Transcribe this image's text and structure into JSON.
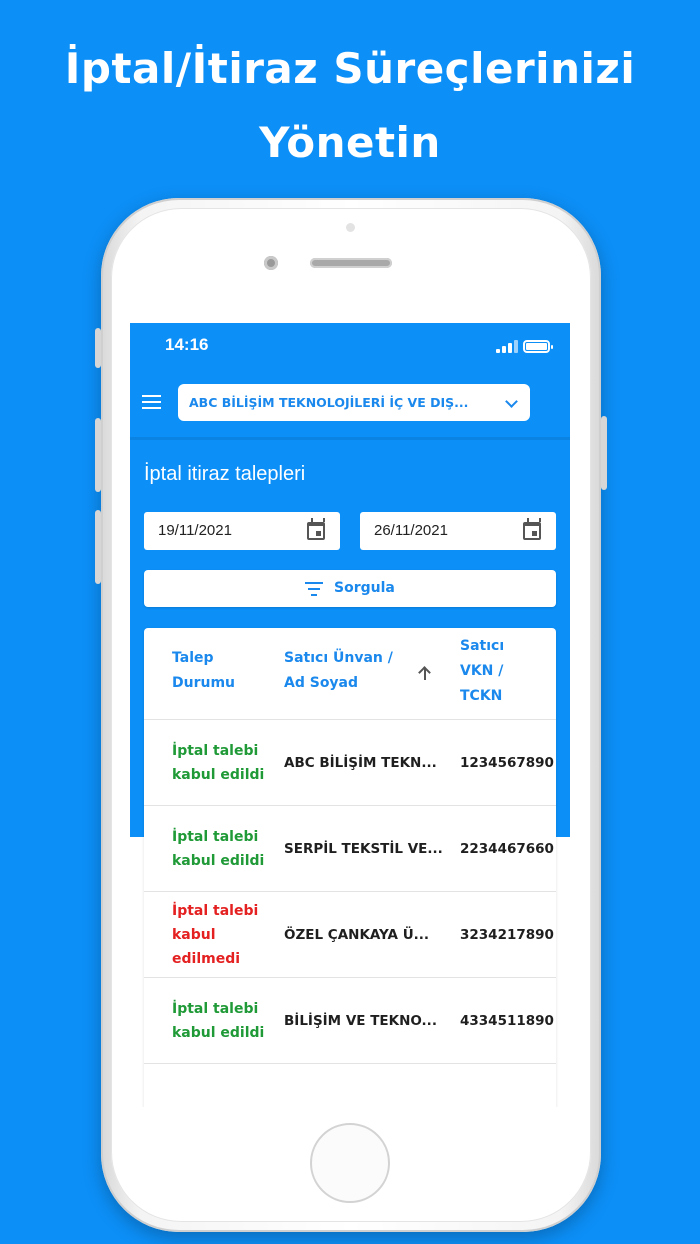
{
  "headline": {
    "line1": "İptal/İtiraz Süreçlerinizi",
    "line2": "Yönetin"
  },
  "status_bar": {
    "time": "14:16"
  },
  "app_bar": {
    "company": "ABC BİLİŞİM TEKNOLOJİLERİ İÇ VE DIŞ..."
  },
  "page": {
    "title": "İptal itiraz talepleri",
    "start_date": "19/11/2021",
    "end_date": "26/11/2021",
    "query_label": "Sorgula"
  },
  "table": {
    "headers": {
      "status": [
        "Talep",
        "Durumu"
      ],
      "seller": [
        "Satıcı Ünvan /",
        "Ad Soyad"
      ],
      "vkn": [
        "Satıcı",
        "VKN /",
        "TCKN"
      ]
    },
    "rows": [
      {
        "status": [
          "İptal talebi",
          "kabul edildi"
        ],
        "name": "ABC BİLİŞİM TEKN...",
        "vkn": "1234567890"
      },
      {
        "status": [
          "İptal talebi",
          "kabul edildi"
        ],
        "name": "SERPİL TEKSTİL VE...",
        "vkn": "2234467660"
      },
      {
        "status": [
          "İptal talebi",
          "kabul",
          "edilmedi"
        ],
        "name": "ÖZEL ÇANKAYA Ü...",
        "vkn": "3234217890"
      },
      {
        "status": [
          "İptal talebi",
          "kabul edildi"
        ],
        "name": "BİLİŞİM VE TEKNO...",
        "vkn": "4334511890"
      }
    ]
  },
  "colors": {
    "background": "#0c8ff7",
    "accent": "#1a88ec",
    "accepted": "#1f9a37",
    "rejected": "#e42020"
  },
  "icons": [
    "menu-icon",
    "chevron-down-icon",
    "calendar-icon",
    "filter-icon",
    "sort-up-icon",
    "signal-icon",
    "battery-icon"
  ]
}
